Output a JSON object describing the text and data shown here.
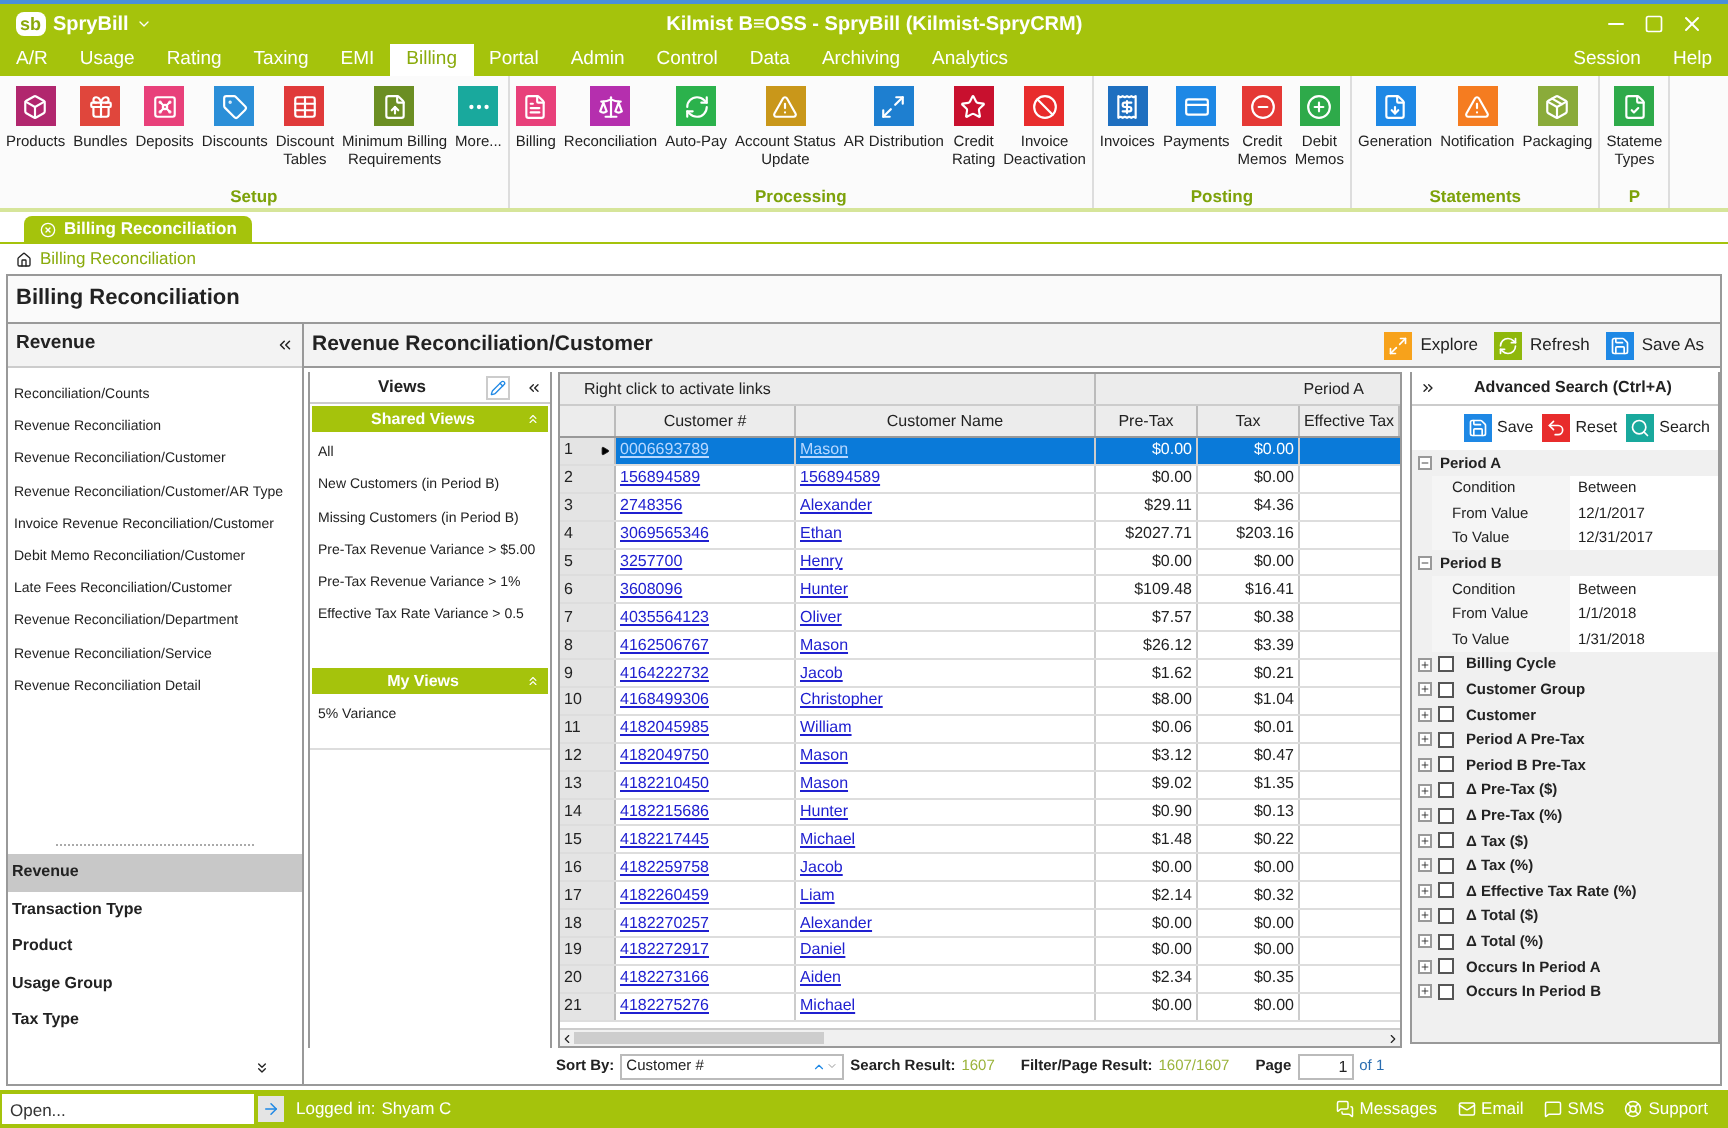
{
  "app": {
    "logo": "sb",
    "name": "SpryBill",
    "title": "Kilmist B≡OSS - SpryBill (Kilmist-SpryCRM)"
  },
  "menu": {
    "tabs": [
      {
        "label": "A/R",
        "selected": false
      },
      {
        "label": "Usage",
        "selected": false
      },
      {
        "label": "Rating",
        "selected": false
      },
      {
        "label": "Taxing",
        "selected": false
      },
      {
        "label": "EMI",
        "selected": false
      },
      {
        "label": "Billing",
        "selected": true
      },
      {
        "label": "Portal",
        "selected": false
      },
      {
        "label": "Admin",
        "selected": false
      },
      {
        "label": "Control",
        "selected": false
      },
      {
        "label": "Data",
        "selected": false
      },
      {
        "label": "Archiving",
        "selected": false
      },
      {
        "label": "Analytics",
        "selected": false
      }
    ],
    "right": [
      "Session",
      "Help"
    ]
  },
  "ribbon": [
    {
      "label": "Setup",
      "buttons": [
        {
          "label": "Products",
          "color": "#b1276e"
        },
        {
          "label": "Bundles",
          "color": "#e0463c"
        },
        {
          "label": "Deposits",
          "color": "#e8407a"
        },
        {
          "label": "Discounts",
          "color": "#2b8fd8"
        },
        {
          "label": "Discount\nTables",
          "color": "#e03a3a"
        },
        {
          "label": "Minimum Billing\nRequirements",
          "color": "#6b8e23"
        },
        {
          "label": "More...",
          "color": "#19a99d"
        }
      ]
    },
    {
      "label": "Processing",
      "buttons": [
        {
          "label": "Billing",
          "color": "#e8407a"
        },
        {
          "label": "Reconciliation",
          "color": "#b52fae"
        },
        {
          "label": "Auto-Pay",
          "color": "#2bb24c"
        },
        {
          "label": "Account Status\nUpdate",
          "color": "#c9971a"
        },
        {
          "label": "AR Distribution",
          "color": "#1e7fd0"
        },
        {
          "label": "Credit\nRating",
          "color": "#c8102e"
        },
        {
          "label": "Invoice\nDeactivation",
          "color": "#e82c2c"
        }
      ]
    },
    {
      "label": "Posting",
      "buttons": [
        {
          "label": "Invoices",
          "color": "#1e6fc0"
        },
        {
          "label": "Payments",
          "color": "#1e88e5"
        },
        {
          "label": "Credit\nMemos",
          "color": "#e53935"
        },
        {
          "label": "Debit\nMemos",
          "color": "#2eaa4a"
        }
      ]
    },
    {
      "label": "Statements",
      "buttons": [
        {
          "label": "Generation",
          "color": "#1e88e5"
        },
        {
          "label": "Notification",
          "color": "#f57c20"
        },
        {
          "label": "Packaging",
          "color": "#8aab3a"
        }
      ]
    },
    {
      "label": "P",
      "buttons": [
        {
          "label": "Stateme\nTypes",
          "color": "#2eaa4a"
        }
      ]
    }
  ],
  "doc_tab": "Billing Reconciliation",
  "breadcrumb": "Billing Reconciliation",
  "page_title": "Billing Reconciliation",
  "left": {
    "title": "Revenue",
    "reports": [
      "Reconciliation/Counts",
      "Revenue Reconciliation",
      "Revenue Reconciliation/Customer",
      "Revenue Reconciliation/Customer/AR Type",
      "Invoice Revenue Reconciliation/Customer",
      "Debit Memo Reconciliation/Customer",
      "Late Fees Reconciliation/Customer",
      "Revenue Reconciliation/Department",
      "Revenue Reconciliation/Service",
      "Revenue Reconciliation Detail"
    ],
    "categories": [
      {
        "label": "Revenue",
        "selected": true
      },
      {
        "label": "Transaction Type",
        "selected": false
      },
      {
        "label": "Product",
        "selected": false
      },
      {
        "label": "Usage Group",
        "selected": false
      },
      {
        "label": "Tax Type",
        "selected": false
      }
    ]
  },
  "report": {
    "title": "Revenue Reconciliation/Customer",
    "toolbar": [
      "Explore",
      "Refresh",
      "Save As"
    ]
  },
  "views": {
    "title": "Views",
    "shared_title": "Shared Views",
    "shared": [
      "All",
      "New Customers (in Period B)",
      "Missing Customers (in Period B)",
      "Pre-Tax Revenue Variance > $5.00",
      "Pre-Tax Revenue Variance > 1%",
      "Effective Tax Rate Variance > 0.5"
    ],
    "my_title": "My Views",
    "mine": [
      "5% Variance"
    ]
  },
  "table": {
    "group_headers": [
      "Right click to activate links",
      "Period A"
    ],
    "columns": [
      "Customer #",
      "Customer Name",
      "Pre-Tax",
      "Tax",
      "Effective Tax"
    ],
    "rows": [
      {
        "n": "1",
        "customer": "0006693789",
        "name": "Mason",
        "pretax": "$0.00",
        "tax": "$0.00",
        "selected": true
      },
      {
        "n": "2",
        "customer": "156894589",
        "name": "156894589",
        "pretax": "$0.00",
        "tax": "$0.00",
        "selected": false
      },
      {
        "n": "3",
        "customer": "2748356",
        "name": "Alexander",
        "pretax": "$29.11",
        "tax": "$4.36",
        "selected": false
      },
      {
        "n": "4",
        "customer": "3069565346",
        "name": "Ethan",
        "pretax": "$2027.71",
        "tax": "$203.16",
        "selected": false
      },
      {
        "n": "5",
        "customer": "3257700",
        "name": "Henry",
        "pretax": "$0.00",
        "tax": "$0.00",
        "selected": false
      },
      {
        "n": "6",
        "customer": "3608096",
        "name": "Hunter",
        "pretax": "$109.48",
        "tax": "$16.41",
        "selected": false
      },
      {
        "n": "7",
        "customer": "4035564123",
        "name": "Oliver",
        "pretax": "$7.57",
        "tax": "$0.38",
        "selected": false
      },
      {
        "n": "8",
        "customer": "4162506767",
        "name": "Mason",
        "pretax": "$26.12",
        "tax": "$3.39",
        "selected": false
      },
      {
        "n": "9",
        "customer": "4164222732",
        "name": "Jacob",
        "pretax": "$1.62",
        "tax": "$0.21",
        "selected": false
      },
      {
        "n": "10",
        "customer": "4168499306",
        "name": "Christopher",
        "pretax": "$8.00",
        "tax": "$1.04",
        "selected": false
      },
      {
        "n": "11",
        "customer": "4182045985",
        "name": "William",
        "pretax": "$0.06",
        "tax": "$0.01",
        "selected": false
      },
      {
        "n": "12",
        "customer": "4182049750",
        "name": "Mason",
        "pretax": "$3.12",
        "tax": "$0.47",
        "selected": false
      },
      {
        "n": "13",
        "customer": "4182210450",
        "name": "Mason",
        "pretax": "$9.02",
        "tax": "$1.35",
        "selected": false
      },
      {
        "n": "14",
        "customer": "4182215686",
        "name": "Hunter",
        "pretax": "$0.90",
        "tax": "$0.13",
        "selected": false
      },
      {
        "n": "15",
        "customer": "4182217445",
        "name": "Michael",
        "pretax": "$1.48",
        "tax": "$0.22",
        "selected": false
      },
      {
        "n": "16",
        "customer": "4182259758",
        "name": "Jacob",
        "pretax": "$0.00",
        "tax": "$0.00",
        "selected": false
      },
      {
        "n": "17",
        "customer": "4182260459",
        "name": "Liam",
        "pretax": "$2.14",
        "tax": "$0.32",
        "selected": false
      },
      {
        "n": "18",
        "customer": "4182270257",
        "name": "Alexander",
        "pretax": "$0.00",
        "tax": "$0.00",
        "selected": false
      },
      {
        "n": "19",
        "customer": "4182272917",
        "name": "Daniel",
        "pretax": "$0.00",
        "tax": "$0.00",
        "selected": false
      },
      {
        "n": "20",
        "customer": "4182273166",
        "name": "Aiden",
        "pretax": "$2.34",
        "tax": "$0.35",
        "selected": false
      },
      {
        "n": "21",
        "customer": "4182275276",
        "name": "Michael",
        "pretax": "$0.00",
        "tax": "$0.00",
        "selected": false
      }
    ]
  },
  "sort_bar": {
    "sort_label": "Sort By:",
    "sort_value": "Customer #",
    "search_label": "Search Result:",
    "search_value": "1607",
    "filter_label": "Filter/Page Result:",
    "filter_value": "1607/1607",
    "page_label": "Page",
    "page_value": "1",
    "page_total": "of 1"
  },
  "search": {
    "title": "Advanced Search (Ctrl+A)",
    "actions": [
      "Save",
      "Reset",
      "Search"
    ],
    "groups": [
      {
        "label": "Period A",
        "expanded": true,
        "fields": [
          {
            "label": "Condition",
            "value": "Between"
          },
          {
            "label": "From Value",
            "value": "12/1/2017"
          },
          {
            "label": "To Value",
            "value": "12/31/2017"
          }
        ]
      },
      {
        "label": "Period B",
        "expanded": true,
        "fields": [
          {
            "label": "Condition",
            "value": "Between"
          },
          {
            "label": "From Value",
            "value": "1/1/2018"
          },
          {
            "label": "To Value",
            "value": "1/31/2018"
          }
        ]
      }
    ],
    "filters": [
      {
        "label": "Billing Cycle",
        "checked": false
      },
      {
        "label": "Customer Group",
        "checked": false
      },
      {
        "label": "Customer",
        "checked": false
      },
      {
        "label": "Period A Pre-Tax",
        "checked": false
      },
      {
        "label": "Period B Pre-Tax",
        "checked": false
      },
      {
        "label": "Δ Pre-Tax ($)",
        "checked": false
      },
      {
        "label": "Δ Pre-Tax (%)",
        "checked": false
      },
      {
        "label": "Δ Tax ($)",
        "checked": false
      },
      {
        "label": "Δ Tax (%)",
        "checked": false
      },
      {
        "label": "Δ Effective Tax Rate (%)",
        "checked": false
      },
      {
        "label": "Δ Total ($)",
        "checked": false
      },
      {
        "label": "Δ Total (%)",
        "checked": false
      },
      {
        "label": "Occurs In Period A",
        "checked": false
      },
      {
        "label": "Occurs In Period B",
        "checked": false
      }
    ]
  },
  "status_bar": {
    "open_placeholder": "Open...",
    "logged_label": "Logged in:",
    "user": "Shyam C",
    "items": [
      "Messages",
      "Email",
      "SMS",
      "Support"
    ]
  }
}
